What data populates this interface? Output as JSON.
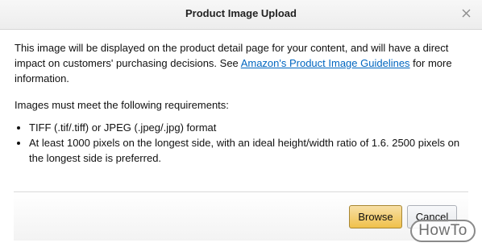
{
  "dialog": {
    "title": "Product Image Upload",
    "intro_before_link": "This image will be displayed on the product detail page for your content, and will have a direct impact on customers' purchasing decisions. See ",
    "intro_link": "Amazon's Product Image Guidelines",
    "intro_after_link": " for more information.",
    "requirements_heading": "Images must meet the following requirements:",
    "requirements": [
      "TIFF (.tif/.tiff) or JPEG (.jpeg/.jpg) format",
      "At least 1000 pixels on the longest side, with an ideal height/width ratio of 1.6. 2500 pixels on the longest side is preferred."
    ],
    "browse_label": "Browse",
    "cancel_label": "Cancel"
  },
  "watermark": {
    "text": "HowTo"
  },
  "icons": {
    "close": "close-icon"
  },
  "colors": {
    "link": "#0066c0",
    "primary_button": "#f0c14b",
    "secondary_button": "#e7e9ec"
  }
}
